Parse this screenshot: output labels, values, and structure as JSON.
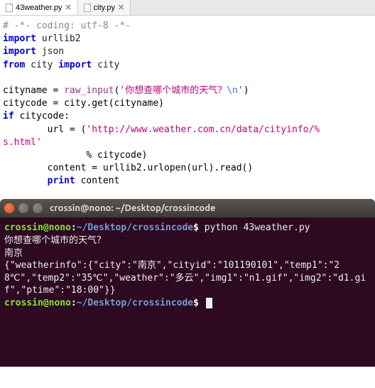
{
  "tabs": [
    {
      "label": "43weather.py",
      "active": true
    },
    {
      "label": "city.py",
      "active": false
    }
  ],
  "code": {
    "l1_comment": "# -*- coding: utf-8 -*-",
    "l2_kw": "import",
    "l2_mod": " urllib2",
    "l3_kw": "import",
    "l3_mod": " json",
    "l4_from": "from",
    "l4_mod1": " city ",
    "l4_import": "import",
    "l4_mod2": " city",
    "l6_var": "cityname ",
    "l6_eq": "= ",
    "l6_func": "raw_input",
    "l6_open": "(",
    "l6_str_a": "'你想查哪个城市的天气？",
    "l6_esc": "\\n",
    "l6_str_b": "'",
    "l6_close": ")",
    "l7": "citycode = city.get(cityname)",
    "l8_if": "if",
    "l8_rest": " citycode:",
    "l9_pre": "        url = (",
    "l9_str": "'http://www.weather.com.cn/data/cityinfo/%",
    "l10_str": "s.html'",
    "l11_pre": "               % citycode)",
    "l12_pre": "        content = urllib2.urlopen(url).read()",
    "l13_pre": "        ",
    "l13_kw": "print",
    "l13_rest": " content"
  },
  "terminal": {
    "title": "crossin@nono: ~/Desktop/crossincode",
    "prompt_user": "crossin@nono",
    "prompt_sep1": ":",
    "prompt_path": "~/Desktop/crossincode",
    "prompt_dollar": "$",
    "cmd": "python 43weather.py",
    "out_l1": "你想查哪个城市的天气？",
    "out_l2": "南京",
    "out_l3": "{\"weatherinfo\":{\"city\":\"南京\",\"cityid\":\"101190101\",\"temp1\":\"28℃\",\"temp2\":\"35℃\",\"weather\":\"多云\",\"img1\":\"n1.gif\",\"img2\":\"d1.gif\",\"ptime\":\"18:00\"}}"
  },
  "chart_data": {
    "type": "table",
    "title": "JSON weather response printed in terminal",
    "rows": [
      {
        "key": "city",
        "value": "南京"
      },
      {
        "key": "cityid",
        "value": "101190101"
      },
      {
        "key": "temp1",
        "value": "28℃"
      },
      {
        "key": "temp2",
        "value": "35℃"
      },
      {
        "key": "weather",
        "value": "多云"
      },
      {
        "key": "img1",
        "value": "n1.gif"
      },
      {
        "key": "img2",
        "value": "d1.gif"
      },
      {
        "key": "ptime",
        "value": "18:00"
      }
    ]
  }
}
